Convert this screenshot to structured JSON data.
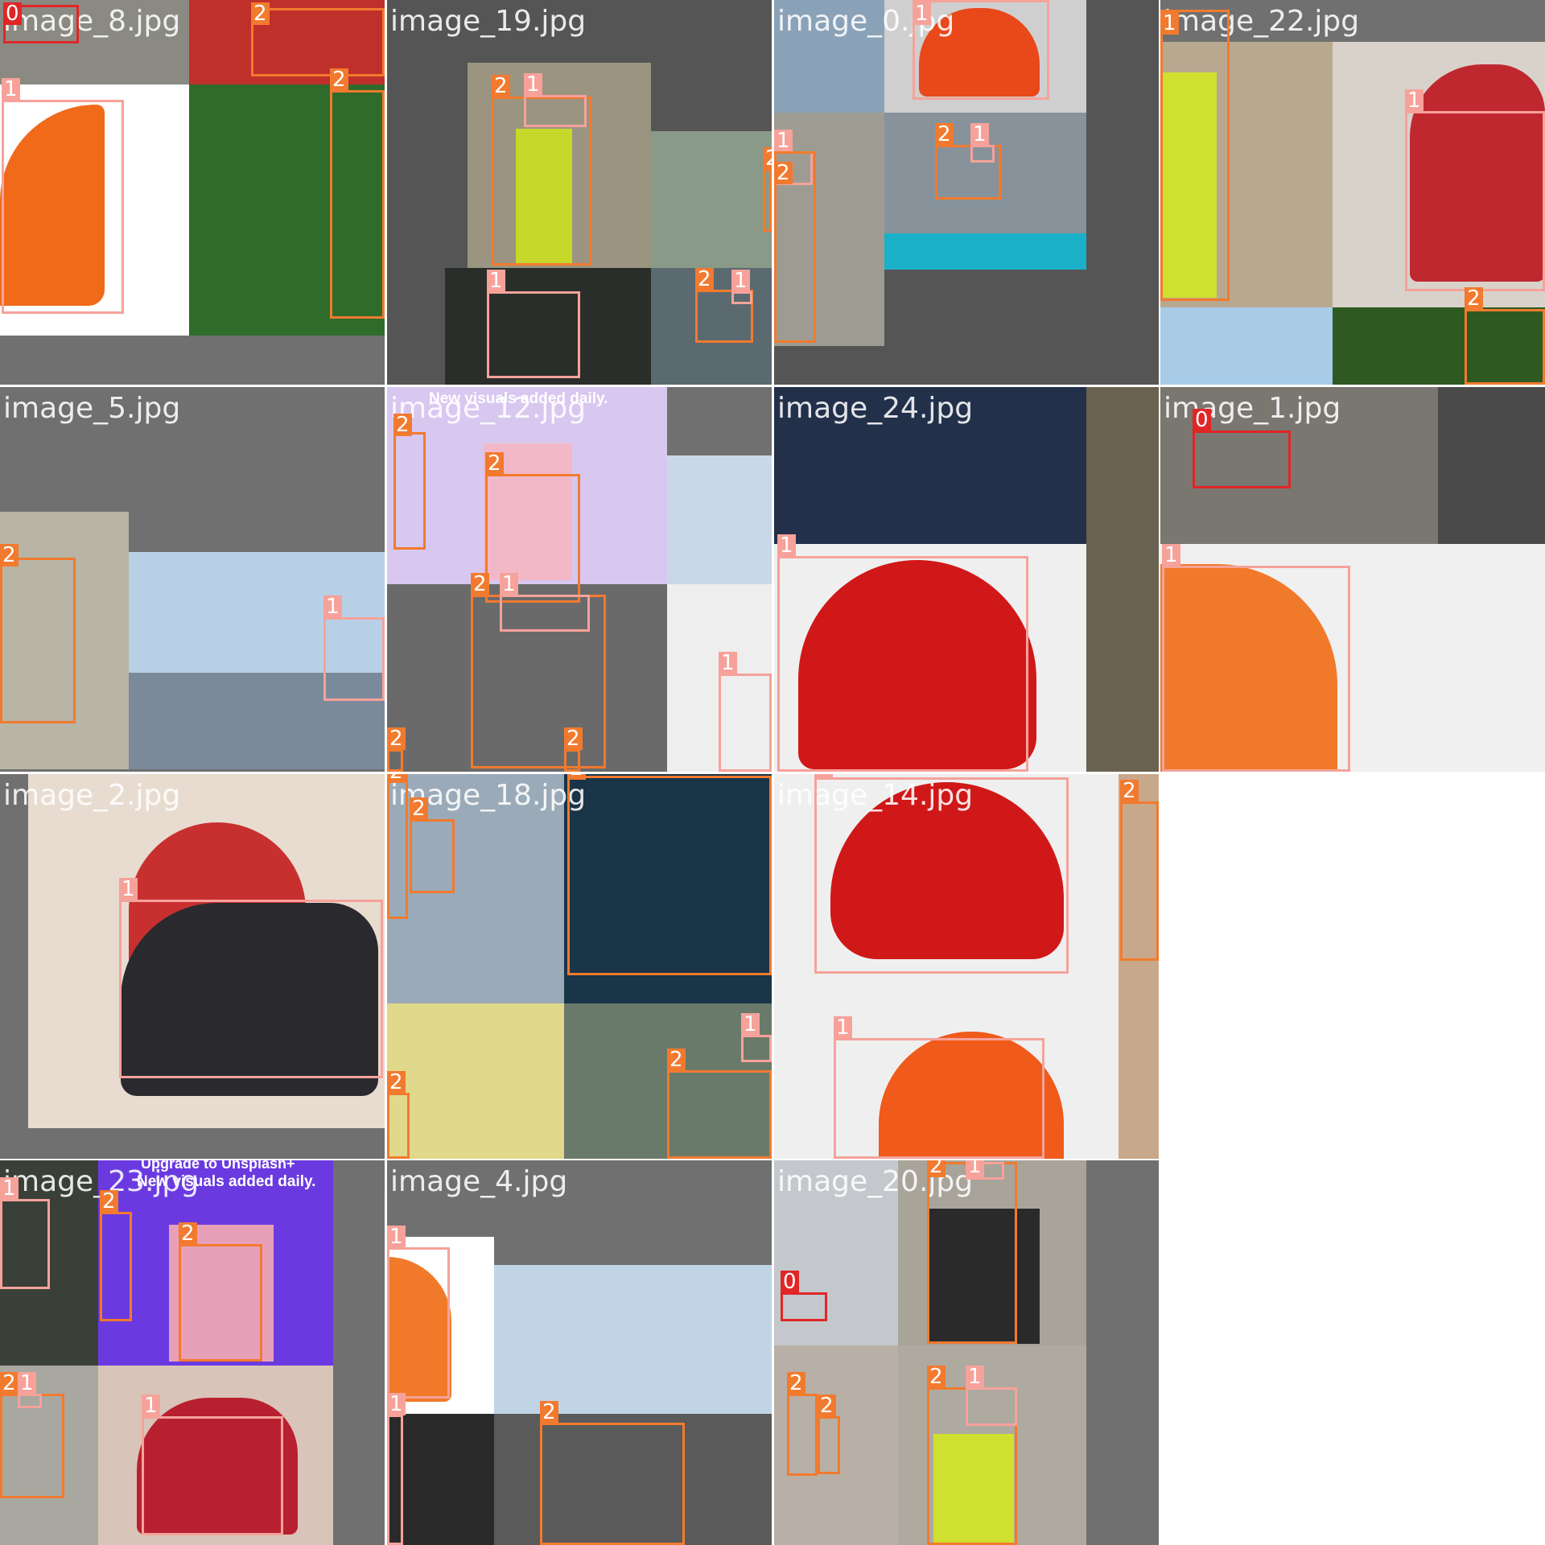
{
  "title": "",
  "colors": {
    "class_0": "#e02626",
    "class_1": "#f6a29a",
    "class_2": "#f27a2e",
    "padding": "#707070"
  },
  "class_labels": {
    "c0": "0",
    "c1": "1",
    "c2": "2"
  },
  "tiles": [
    {
      "name": "image_8.jpg",
      "boxes": [
        "0",
        "2",
        "2",
        "1"
      ]
    },
    {
      "name": "image_19.jpg",
      "boxes": [
        "2",
        "1",
        "2",
        "1",
        "2",
        "1"
      ]
    },
    {
      "name": "image_0.jpg",
      "boxes": [
        "1",
        "1",
        "2",
        "1",
        "2"
      ]
    },
    {
      "name": "image_22.jpg",
      "boxes": [
        "1",
        "1",
        "2"
      ]
    },
    {
      "name": "image_5.jpg",
      "boxes": [
        "2",
        "1"
      ]
    },
    {
      "name": "image_12.jpg",
      "banner": "New visuals added daily.",
      "boxes": [
        "2",
        "2",
        "2",
        "1",
        "1",
        "2",
        "2"
      ]
    },
    {
      "name": "image_24.jpg",
      "boxes": [
        "1"
      ]
    },
    {
      "name": "image_1.jpg",
      "boxes": [
        "0",
        "1"
      ]
    },
    {
      "name": "image_2.jpg",
      "boxes": [
        "1"
      ]
    },
    {
      "name": "image_18.jpg",
      "boxes": [
        "2",
        "2",
        "2",
        "1",
        "2",
        "2"
      ]
    },
    {
      "name": "image_14.jpg",
      "boxes": [
        "1",
        "2",
        "1"
      ]
    },
    {
      "name": "image_23.jpg",
      "banner_top": "Upgrade to Unsplash+",
      "banner": "New visuals added daily.",
      "boxes": [
        "1",
        "2",
        "2",
        "2",
        "1",
        "1"
      ]
    },
    {
      "name": "image_4.jpg",
      "boxes": [
        "1",
        "1",
        "2"
      ]
    },
    {
      "name": "image_20.jpg",
      "boxes": [
        "2",
        "1",
        "0",
        "2",
        "2",
        "2",
        "1"
      ]
    }
  ]
}
